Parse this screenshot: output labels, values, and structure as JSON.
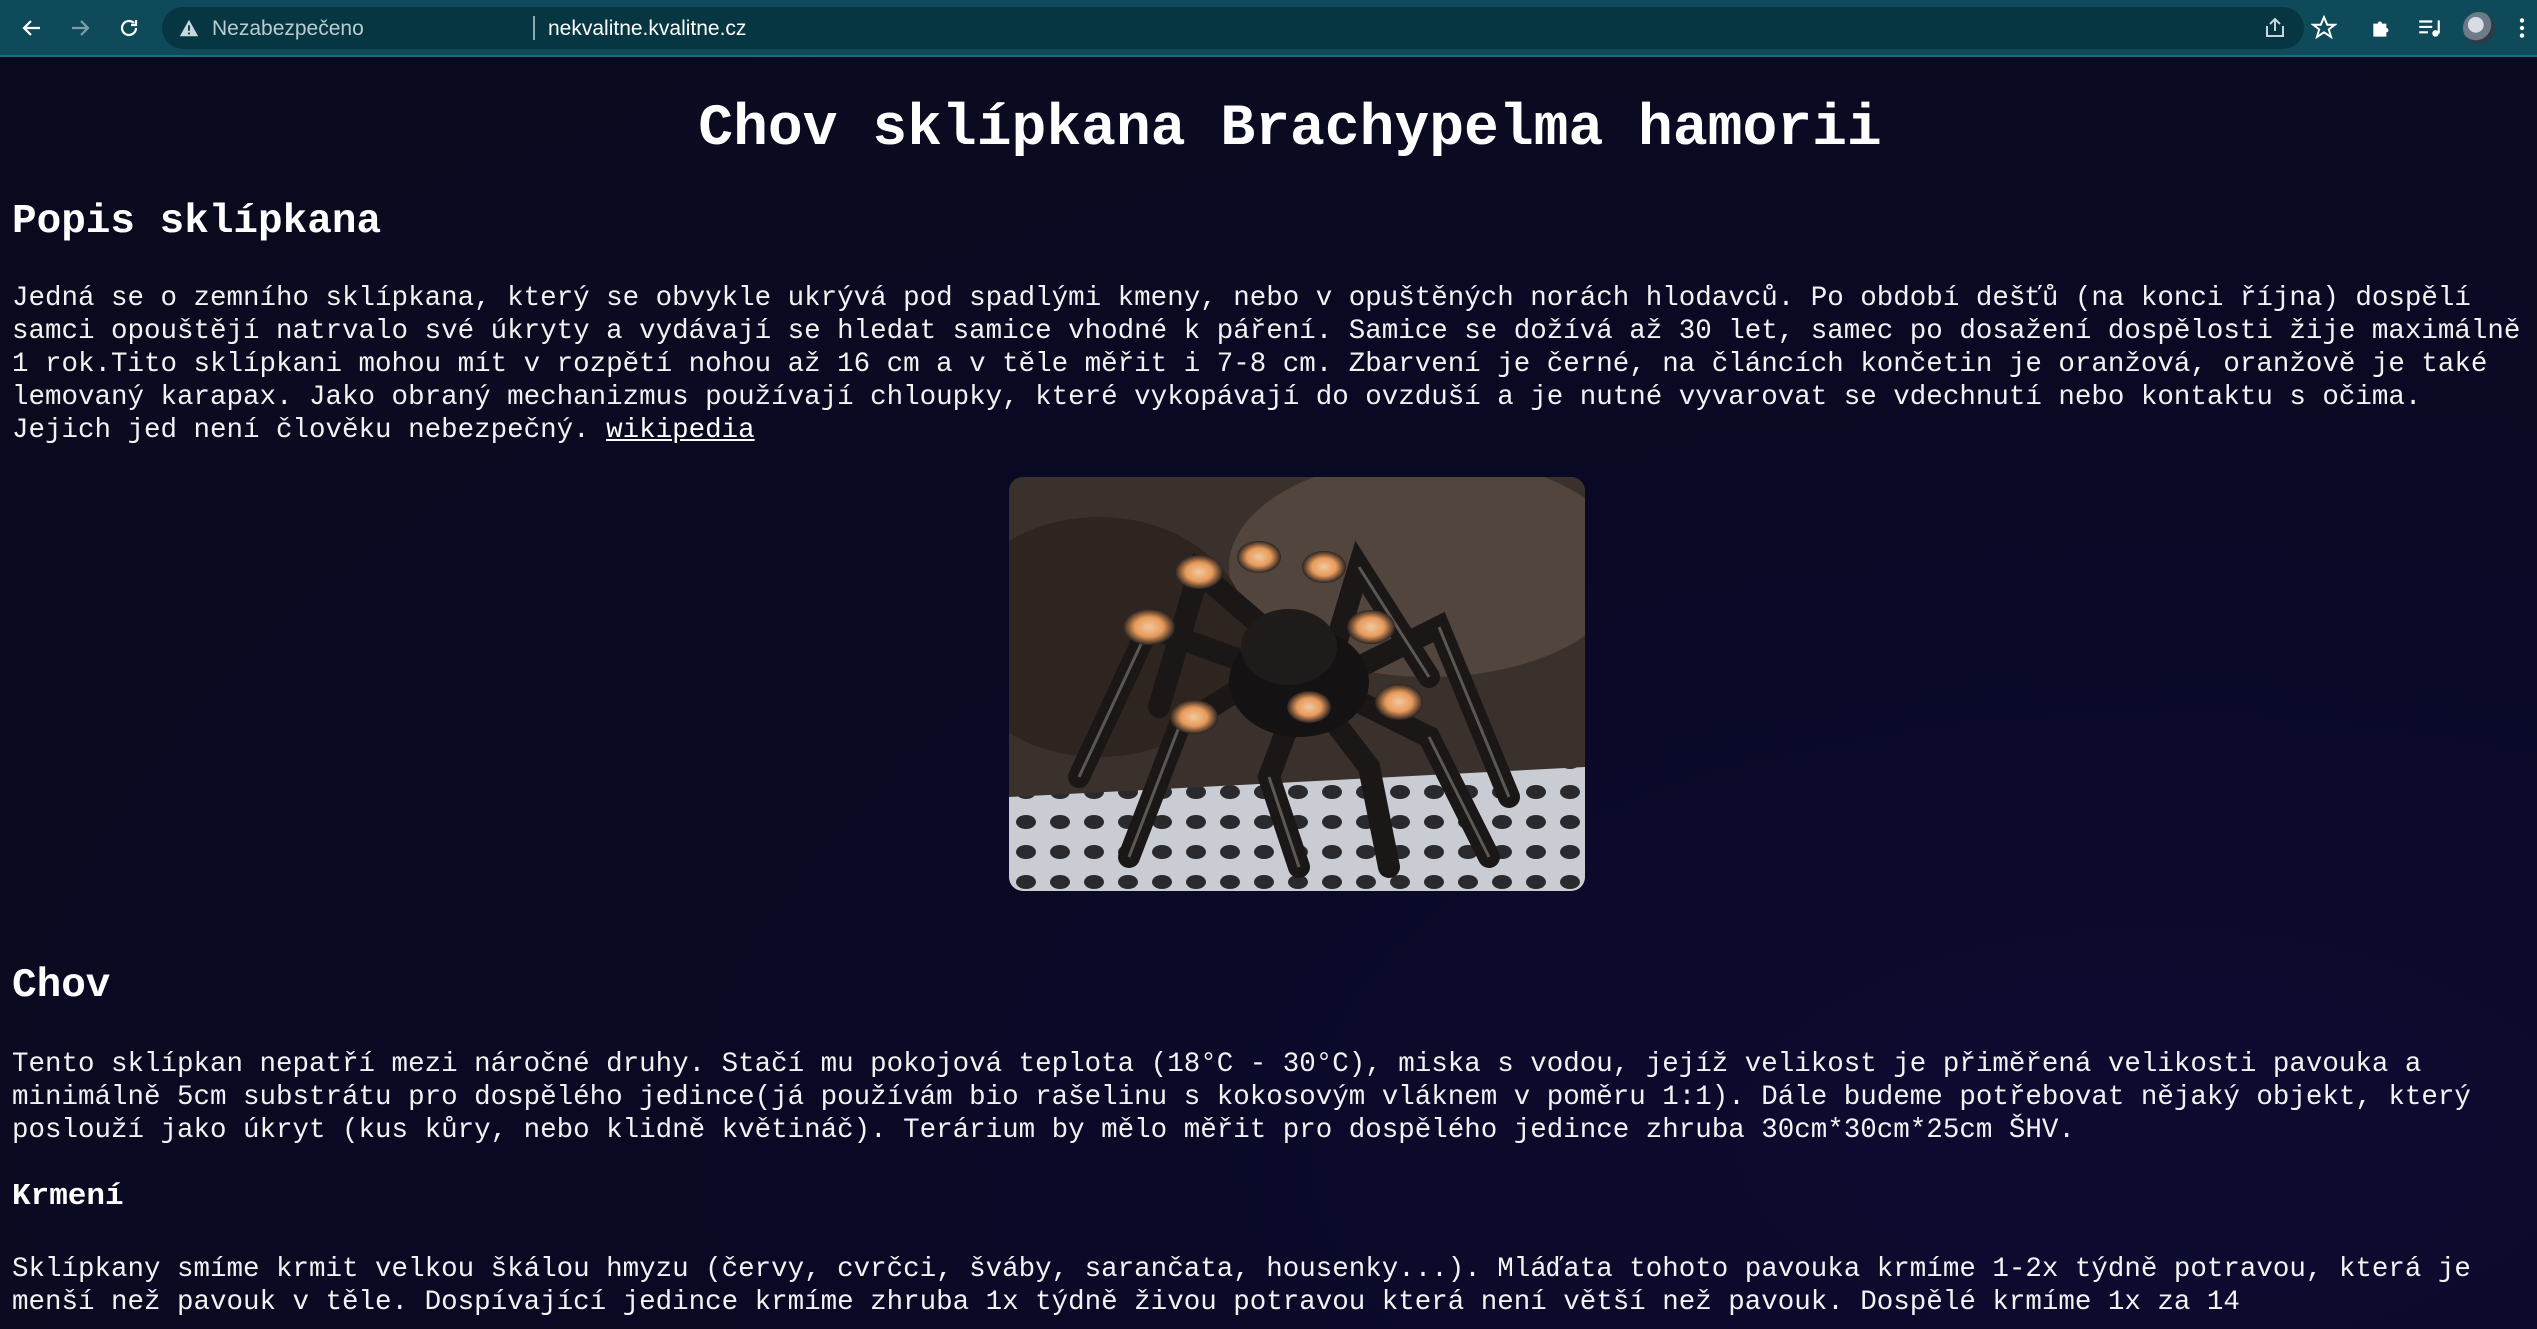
{
  "browser": {
    "security_label": "Nezabezpečeno",
    "url": "nekvalitne.kvalitne.cz",
    "icons": [
      "back-arrow-icon",
      "forward-arrow-icon",
      "reload-icon",
      "warning-icon",
      "share-icon",
      "star-icon",
      "puzzle-icon",
      "media-icon",
      "avatar",
      "more-icon"
    ]
  },
  "page": {
    "title": "Chov sklípkana Brachypelma hamorii",
    "section1": {
      "heading": "Popis sklípkana",
      "text": "Jedná se o zemního sklípkana, který se obvykle ukrývá pod spadlými kmeny, nebo v opuštěných norách hlodavců. Po období dešťů (na konci října) dospělí samci opouštějí natrvalo své úkryty a vydávají se hledat samice vhodné k páření. Samice se dožívá až 30 let, samec po dosažení dospělosti žije maximálně 1 rok.Tito sklípkani mohou mít v rozpětí nohou až 16 cm a v těle měřit i 7-8 cm. Zbarvení je černé, na článcích končetin je oranžová, oranžově je také lemovaný karapax. Jako obraný mechanizmus používají chloupky, které vykopávají do ovzduší a je nutné vyvarovat se vdechnutí nebo kontaktu s očima. Jejich jed není člověku nebezpečný.",
      "link": "wikipedia"
    },
    "section2": {
      "heading": "Chov",
      "text": "Tento sklípkan nepatří mezi náročné druhy. Stačí mu pokojová teplota (18°C - 30°C), miska s vodou, jejíž velikost je přiměřená velikosti pavouka a minimálně 5cm substrátu pro dospělého jedince(já používám bio rašelinu s kokosovým vláknem v poměru 1:1). Dále budeme potřebovat nějaký objekt, který poslouží jako úkryt (kus kůry, nebo klidně květináč). Terárium by mělo měřit pro dospělého jedince zhruba 30cm*30cm*25cm ŠHV."
    },
    "section3": {
      "heading": "Krmení",
      "text": "Sklípkany smíme krmit velkou škálou hmyzu (červy, cvrčci, šváby, sarančata, housenky...). Mláďata tohoto pavouka krmíme 1-2x týdně potravou, která je menší než pavouk v těle. Dospívající jedince krmíme zhruba 1x týdně živou potravou která není větší než pavouk. Dospělé krmíme 1x za 14"
    }
  }
}
